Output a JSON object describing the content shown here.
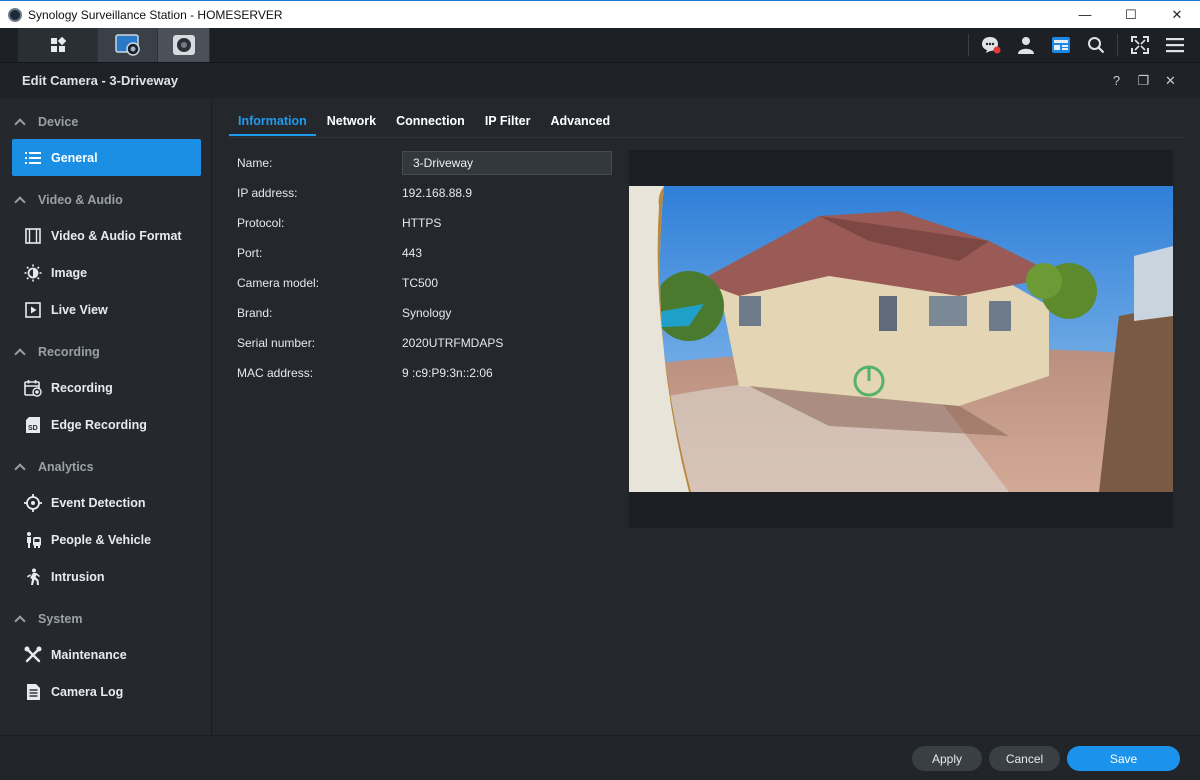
{
  "window": {
    "title": "Synology Surveillance Station - HOMESERVER",
    "minimize": "—",
    "maximize": "☐",
    "close": "✕"
  },
  "toolbar": {
    "left_icons": [
      "apps-grid-icon",
      "camera-window-icon",
      "camera-icon"
    ],
    "right_icons": [
      "notification-icon",
      "user-icon",
      "widget-icon",
      "search-icon",
      "fullscreen-icon",
      "menu-icon"
    ]
  },
  "dialog": {
    "title": "Edit Camera - 3-Driveway",
    "help": "?",
    "restore": "❐",
    "close": "✕"
  },
  "sidebar": {
    "sections": [
      {
        "label": "Device",
        "items": [
          {
            "label": "General",
            "icon": "list-icon",
            "active": true
          }
        ]
      },
      {
        "label": "Video & Audio",
        "items": [
          {
            "label": "Video & Audio Format",
            "icon": "film-icon"
          },
          {
            "label": "Image",
            "icon": "brightness-icon"
          },
          {
            "label": "Live View",
            "icon": "play-icon"
          }
        ]
      },
      {
        "label": "Recording",
        "items": [
          {
            "label": "Recording",
            "icon": "calendar-record-icon"
          },
          {
            "label": "Edge Recording",
            "icon": "sd-card-icon"
          }
        ]
      },
      {
        "label": "Analytics",
        "items": [
          {
            "label": "Event Detection",
            "icon": "crosshair-icon"
          },
          {
            "label": "People & Vehicle",
            "icon": "people-vehicle-icon"
          },
          {
            "label": "Intrusion",
            "icon": "intrusion-icon"
          }
        ]
      },
      {
        "label": "System",
        "items": [
          {
            "label": "Maintenance",
            "icon": "tools-icon"
          },
          {
            "label": "Camera Log",
            "icon": "log-icon"
          }
        ]
      }
    ]
  },
  "tabs": [
    {
      "label": "Information",
      "active": true
    },
    {
      "label": "Network"
    },
    {
      "label": "Connection"
    },
    {
      "label": "IP Filter"
    },
    {
      "label": "Advanced"
    }
  ],
  "info": {
    "name_label": "Name:",
    "name_value": "3-Driveway",
    "ip_label": "IP address:",
    "ip_value": "192.168.88.9",
    "protocol_label": "Protocol:",
    "protocol_value": "HTTPS",
    "port_label": "Port:",
    "port_value": "443",
    "model_label": "Camera model:",
    "model_value": "TC500",
    "brand_label": "Brand:",
    "brand_value": "Synology",
    "serial_label": "Serial number:",
    "serial_value": "2020UTRFMDAPS",
    "mac_label": "MAC address:",
    "mac_value": "9 :c9:P9:3n::2:06"
  },
  "footer": {
    "apply": "Apply",
    "cancel": "Cancel",
    "save": "Save"
  },
  "colors": {
    "accent": "#1a8fe3",
    "background": "#24282d"
  }
}
